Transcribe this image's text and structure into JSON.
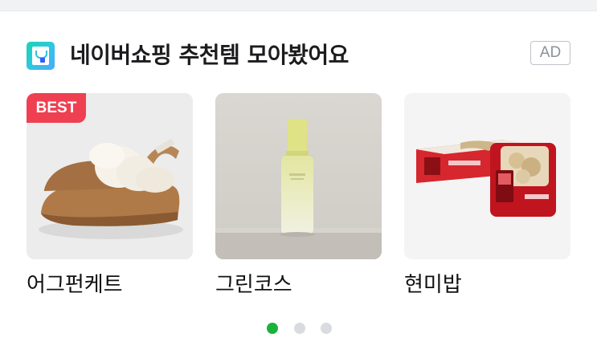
{
  "header": {
    "logo_icon": "naver-shopping-bag-icon",
    "title": "네이버쇼핑 추천템 모아봤어요",
    "ad_label": "AD"
  },
  "products": [
    {
      "name": "어그펀케트",
      "badge": "BEST",
      "image": "sheepskin-platform-slipper"
    },
    {
      "name": "그린코스",
      "badge": "",
      "image": "green-skincare-bottle"
    },
    {
      "name": "현미밥",
      "badge": "",
      "image": "packaged-brown-rice-tray"
    }
  ],
  "pagination": {
    "total": 3,
    "active_index": 0
  },
  "colors": {
    "badge_red": "#ef4052",
    "active_dot": "#19b33b",
    "inactive_dot": "#d9dbe0"
  }
}
